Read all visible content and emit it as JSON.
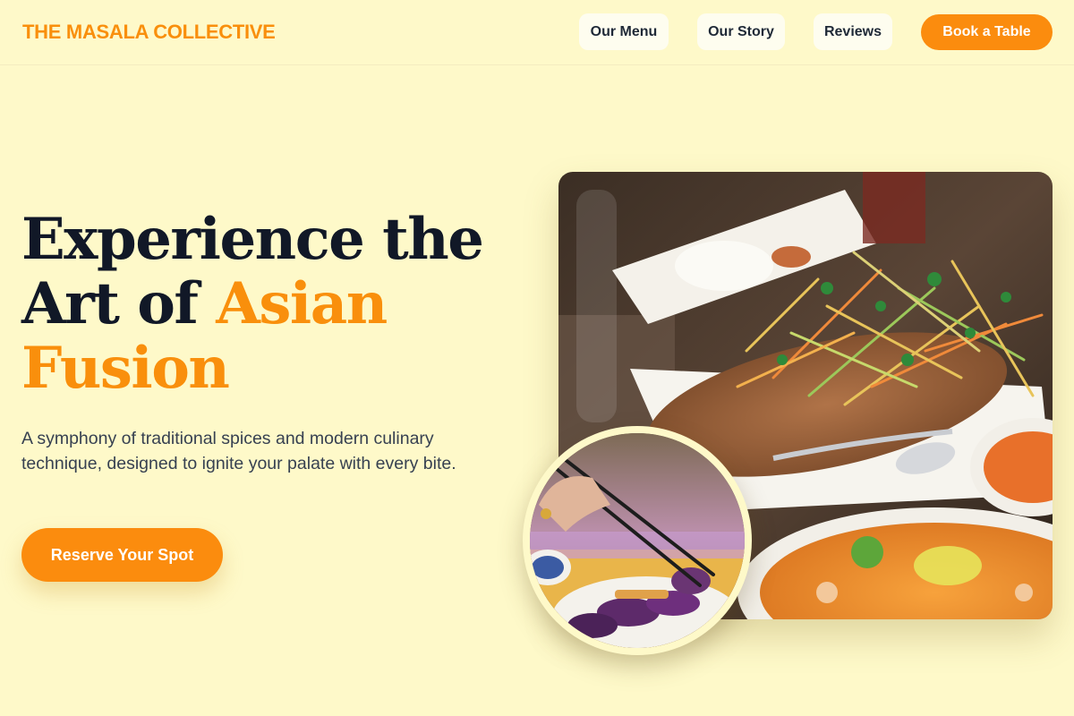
{
  "brand": {
    "name": "THE MASALA COLLECTIVE"
  },
  "nav": {
    "links": [
      "Our Menu",
      "Our Story",
      "Reviews"
    ],
    "cta": "Book a Table"
  },
  "hero": {
    "title_line1": "Experience the",
    "title_line2_plain": "Art of ",
    "title_line2_accent": "Asian",
    "title_line3_accent": "Fusion",
    "subtitle": "A symphony of traditional spices and modern culinary technique, designed to ignite your palate with every bite.",
    "cta": "Reserve Your Spot"
  },
  "images": {
    "main": "fried-fish-salad-dish-photo",
    "circle": "chopsticks-eggplant-dish-photo"
  },
  "colors": {
    "background": "#fef9c9",
    "accent": "#f98f0c",
    "button": "#fb8c0e",
    "heading": "#111827",
    "body_text": "#374151"
  }
}
